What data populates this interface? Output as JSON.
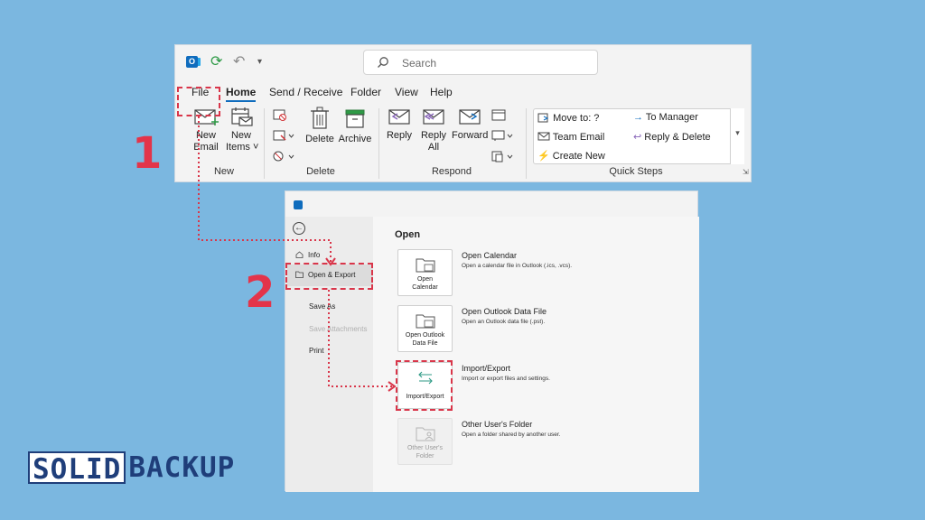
{
  "ribbon": {
    "search_placeholder": "Search",
    "menu": [
      "File",
      "Home",
      "Send / Receive",
      "Folder",
      "View",
      "Help"
    ],
    "new_email": [
      "New",
      "Email"
    ],
    "new_items": [
      "New",
      "Items ˅"
    ],
    "delete": "Delete",
    "archive": "Archive",
    "reply": "Reply",
    "reply_all": [
      "Reply",
      "All"
    ],
    "forward": "Forward",
    "groups": {
      "new": "New",
      "delete": "Delete",
      "respond": "Respond",
      "quick_steps": "Quick Steps"
    },
    "quick_steps": {
      "move_to": "Move to: ?",
      "to_manager": "To Manager",
      "team_email": "Team Email",
      "reply_delete": "Reply & Delete",
      "create_new": "Create New"
    }
  },
  "backstage": {
    "nav": {
      "info": "Info",
      "open_export": "Open & Export",
      "save_as": "Save As",
      "save_attachments": "Save Attachments",
      "print": "Print"
    },
    "heading": "Open",
    "items": [
      {
        "tile": [
          "Open",
          "Calendar"
        ],
        "title": "Open Calendar",
        "desc": "Open a calendar file in Outlook (.ics, .vcs)."
      },
      {
        "tile": [
          "Open Outlook",
          "Data File"
        ],
        "title": "Open Outlook Data File",
        "desc": "Open an Outlook data file (.pst)."
      },
      {
        "tile": [
          "Import/Export"
        ],
        "title": "Import/Export",
        "desc": "Import or export files and settings."
      },
      {
        "tile": [
          "Other User's",
          "Folder"
        ],
        "title": "Other User's Folder",
        "desc": "Open a folder shared by another user."
      }
    ]
  },
  "steps": {
    "one": "1",
    "two": "2"
  },
  "brand": {
    "part1": "SOLID",
    "part2": "BACKUP"
  },
  "colors": {
    "background": "#7bb7e0",
    "highlight": "#d9364a",
    "outlook_blue": "#0f6cbd",
    "brand_navy": "#1f3e7a"
  }
}
